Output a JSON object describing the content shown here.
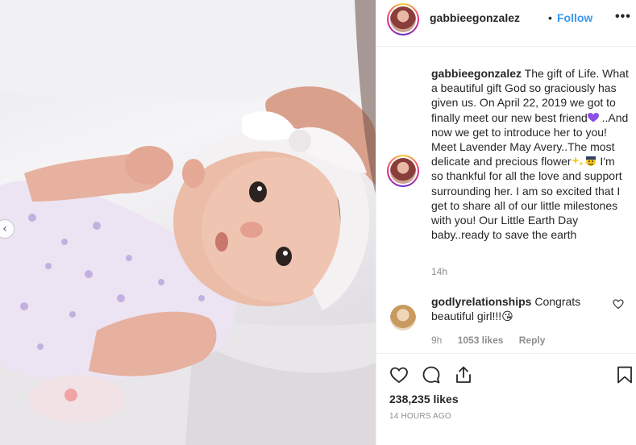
{
  "post": {
    "username": "gabbieegonzalez",
    "separator": "•",
    "follow_label": "Follow",
    "more_label": "•••",
    "photo_prev_label": "‹",
    "icon_names": [
      "heart-icon",
      "comment-icon",
      "share-icon",
      "bookmark-icon",
      "more-options-icon",
      "chevron-left-icon"
    ]
  },
  "caption": {
    "username": "gabbieegonzalez",
    "part1": " The gift of Life. What a beautiful gift God so graciously has given us. On April 22, 2019 we got to finally meet our new best friend",
    "part2": " ..And now we get to introduce her to you! Meet Lavender May Avery..The most delicate and precious flower",
    "part3": " I'm so thankful for all the love and support surrounding her. I am so excited that I get to share all of our little milestones with you! Our Little Earth Day baby..ready to save the earth",
    "time": "14h"
  },
  "comment": {
    "username": "godlyrelationships",
    "text": " Congrats beautiful girl!!!",
    "emoji": "😘",
    "time": "9h",
    "likes": "1053 likes",
    "reply_label": "Reply"
  },
  "engagement": {
    "likes": "238,235 likes",
    "time_ago": "14 HOURS AGO"
  },
  "colors": {
    "link_blue": "#3897f0",
    "text": "#262626",
    "muted": "#8e8e8e",
    "heart_emoji": "#8a4fe8"
  }
}
